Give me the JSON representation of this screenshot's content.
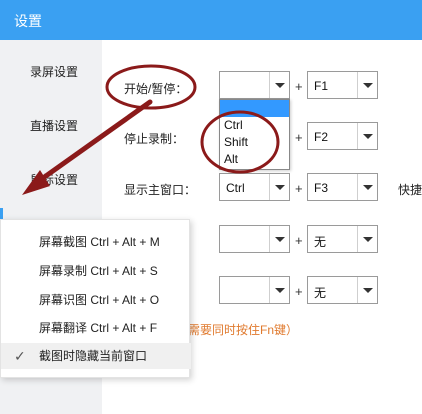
{
  "window": {
    "title": "设置"
  },
  "sidebar": {
    "items": [
      {
        "label": "录屏设置"
      },
      {
        "label": "直播设置"
      },
      {
        "label": "鼠标设置"
      }
    ]
  },
  "hotkeys": {
    "rows": [
      {
        "label": "开始/暂停：",
        "modifier": "",
        "key": "F1"
      },
      {
        "label": "停止录制：",
        "modifier": "",
        "key": "F2"
      },
      {
        "label": "显示主窗口：",
        "modifier": "Ctrl",
        "key": "F3"
      },
      {
        "label": "",
        "modifier": "",
        "key": "无"
      },
      {
        "label": "",
        "modifier": "",
        "key": "无"
      }
    ],
    "plus": "+",
    "tail_label": "快捷",
    "note": "上需要同时按住Fn键）"
  },
  "modifier_dropdown": {
    "options": [
      "",
      "Ctrl",
      "Shift",
      "Alt"
    ],
    "selected_index": 0
  },
  "context_menu": {
    "items": [
      {
        "label": "屏幕截图 Ctrl + Alt + M",
        "checked": false
      },
      {
        "label": "屏幕录制 Ctrl + Alt + S",
        "checked": false
      },
      {
        "label": "屏幕识图 Ctrl + Alt + O",
        "checked": false
      },
      {
        "label": "屏幕翻译 Ctrl + Alt + F",
        "checked": false
      },
      {
        "label": "截图时隐藏当前窗口",
        "checked": true
      }
    ],
    "check_glyph": "✓"
  },
  "colors": {
    "titlebar": "#3aa0f2",
    "sidebar": "#f0f1f3",
    "annotation": "#8b1a1a",
    "note_text": "#e07a2e",
    "selected_option": "#3399ff"
  }
}
